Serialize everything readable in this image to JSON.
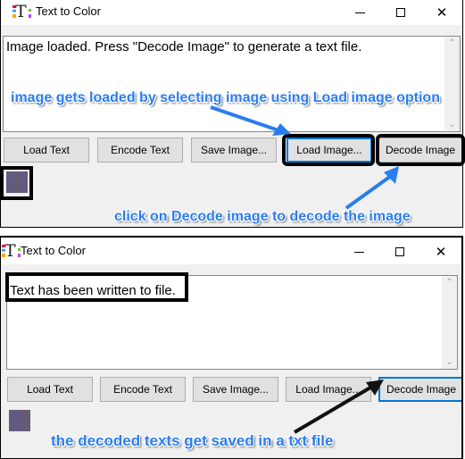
{
  "windows": [
    {
      "title": "Text to Color",
      "status_text": "Image loaded.  Press \"Decode Image\" to generate a text file.",
      "buttons": [
        "Load Text",
        "Encode Text",
        "Save Image...",
        "Load Image...",
        "Decode Image"
      ],
      "focused_button": "Load Image...",
      "annotations": [
        "image gets loaded by selecting image using Load image option",
        "click on Decode image to decode the image"
      ]
    },
    {
      "title": "Text to Color",
      "status_text": "Text has been written to file.",
      "buttons": [
        "Load Text",
        "Encode Text",
        "Save Image...",
        "Load Image...",
        "Decode Image"
      ],
      "focused_button": "Decode Image",
      "annotations": [
        "the decoded texts get saved in a txt file"
      ]
    }
  ],
  "window_controls": {
    "minimize": "minimize-icon",
    "maximize": "maximize-icon",
    "close": "✕"
  },
  "colors": {
    "annotation_text": "#2a7df0",
    "annotation_arrow_1": "#2a7df0",
    "annotation_arrow_2": "#111111",
    "focus_border": "#0078d7"
  }
}
